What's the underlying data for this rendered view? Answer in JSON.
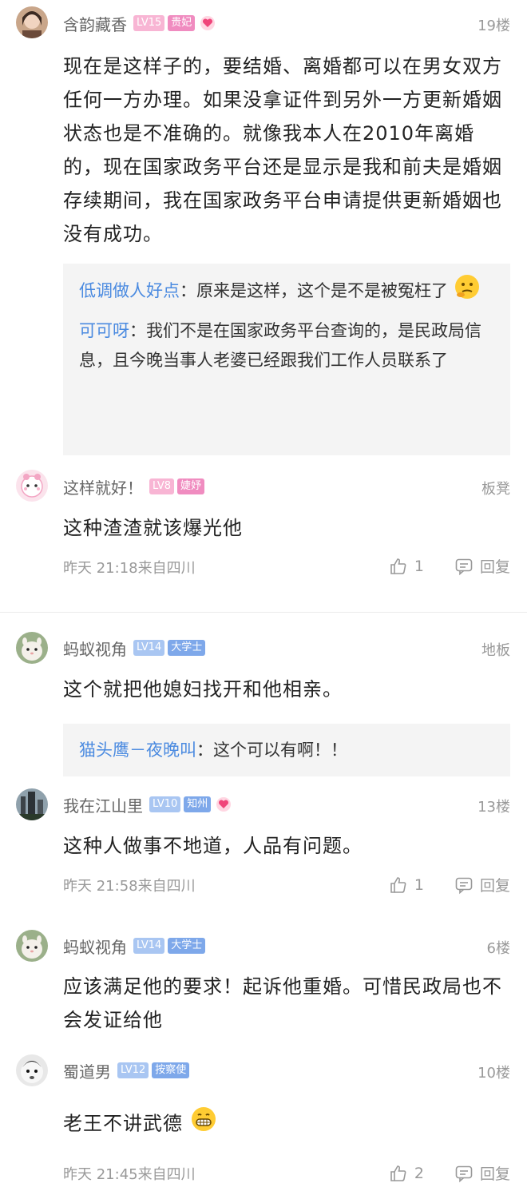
{
  "colors": {
    "link_blue": "#4a8ae0",
    "meta_gray": "#999999",
    "pink_badge": "#f08cc0",
    "blue_badge": "#7ea8ea"
  },
  "comments": [
    {
      "username": "含韵藏香",
      "level": "LV15",
      "title": "贵妃",
      "floor": "19楼",
      "content": "现在是这样子的，要结婚、离婚都可以在男女双方任何一方办理。如果没拿证件到另外一方更新婚姻状态也是不准确的。就像我本人在2010年离婚的，现在国家政务平台还是显示是我和前夫是婚姻存续期间，我在国家政务平台申请提供更新婚姻也没有成功。",
      "replies": [
        {
          "name": "低调做人好点",
          "text": "原来是这样，这个是不是被冤枉了"
        },
        {
          "name": "可可呀",
          "text": "我们不是在国家政务平台查询的，是民政局信息，且今晚当事人老婆已经跟我们工作人员联系了"
        }
      ]
    },
    {
      "username": "这样就好！",
      "level": "LV8",
      "title": "婕妤",
      "floor": "板凳",
      "content": "这种渣渣就该爆光他",
      "time": "昨天 21:18来自四川",
      "likes": "1",
      "reply_label": "回复"
    },
    {
      "username": "蚂蚁视角",
      "level": "LV14",
      "title": "大学士",
      "floor": "地板",
      "content": "这个就把他媳妇找开和他相亲。",
      "replies": [
        {
          "name": "猫头鹰－夜晚叫",
          "text": "这个可以有啊！！"
        }
      ]
    },
    {
      "username": "我在江山里",
      "level": "LV10",
      "title": "知州",
      "floor": "13楼",
      "content": "这种人做事不地道，人品有问题。",
      "time": "昨天 21:58来自四川",
      "likes": "1",
      "reply_label": "回复"
    },
    {
      "username": "蚂蚁视角",
      "level": "LV14",
      "title": "大学士",
      "floor": "6楼",
      "content": "应该满足他的要求！起诉他重婚。可惜民政局也不会发证给他"
    },
    {
      "username": "蜀道男",
      "level": "LV12",
      "title": "按察使",
      "floor": "10楼",
      "content": "老王不讲武德",
      "time": "昨天 21:45来自四川",
      "likes": "2",
      "reply_label": "回复"
    }
  ],
  "icons": [
    "heart-badge-icon",
    "thinking-emoji-icon",
    "grin-emoji-icon",
    "thumbs-up-icon",
    "reply-icon"
  ],
  "reply_separator": "："
}
